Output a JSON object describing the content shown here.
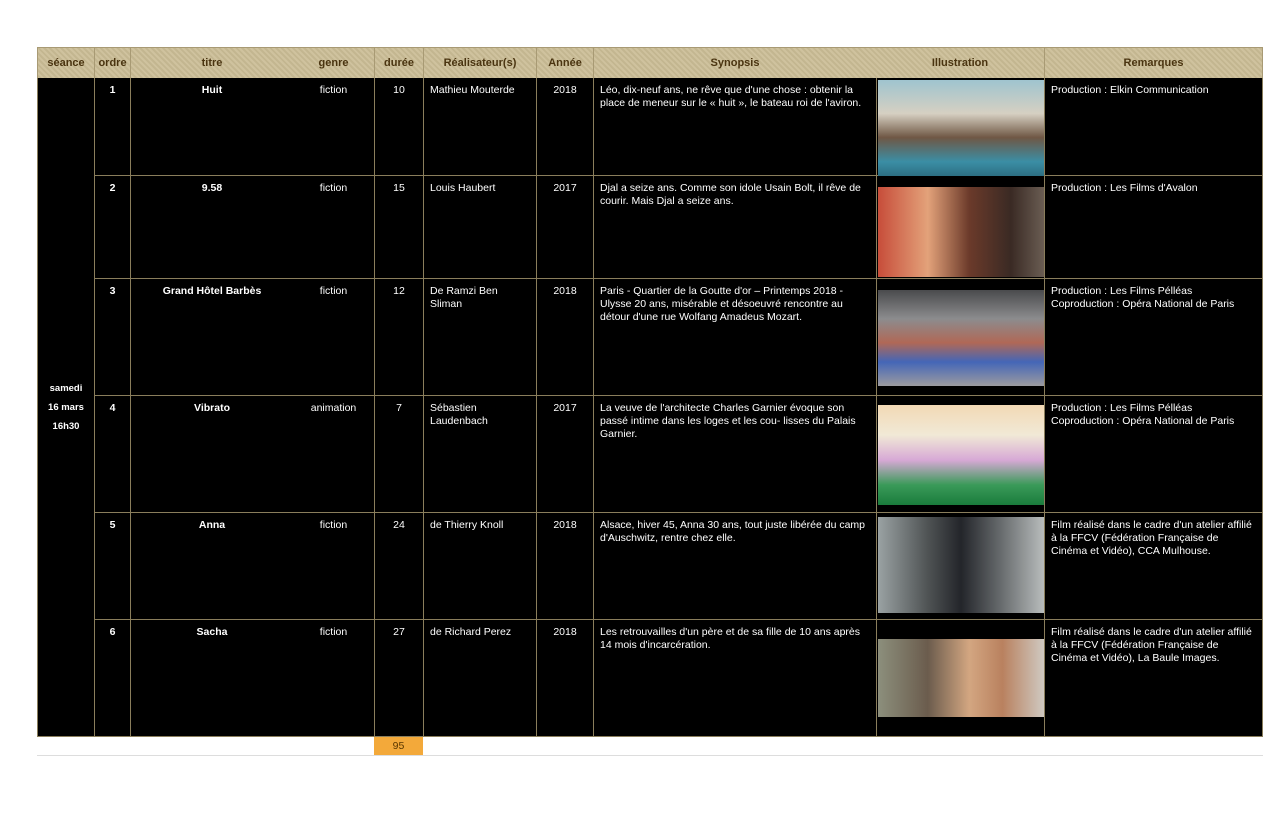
{
  "headers": {
    "seance": "séance",
    "ordre": "ordre",
    "titre": "titre",
    "genre": "genre",
    "duree": "durée",
    "realisateur": "Réalisateur(s)",
    "annee": "Année",
    "synopsis": "Synopsis",
    "illustration": "Illustration",
    "remarques": "Remarques"
  },
  "session": {
    "day": "samedi",
    "date": "16 mars",
    "time": "16h30"
  },
  "films": [
    {
      "ordre": "1",
      "titre": "Huit",
      "genre": "fiction",
      "duree": "10",
      "realisateur": "Mathieu Mouterde",
      "annee": "2018",
      "synopsis": "Léo, dix-neuf ans, ne rêve que d'une chose : obtenir la place de meneur sur le « huit », le bateau roi de l'aviron.",
      "remarques": "Production : Elkin Communication",
      "illustration": "photo-rowing"
    },
    {
      "ordre": "2",
      "titre": "9.58",
      "genre": "fiction",
      "duree": "15",
      "realisateur": "Louis Haubert",
      "annee": "2017",
      "synopsis": "Djal a seize ans. Comme son idole Usain Bolt, il rêve de courir. Mais Djal a seize ans.",
      "remarques": "Production : Les Films d'Avalon",
      "illustration": "photo-runner"
    },
    {
      "ordre": "3",
      "titre": "Grand Hôtel Barbès",
      "genre": "fiction",
      "duree": "12",
      "realisateur": "De Ramzi Ben Sliman",
      "annee": "2018",
      "synopsis": "Paris - Quartier de la Goutte d'or – Printemps 2018 - Ulysse 20 ans, misérable et désoeuvré rencontre au détour d'une rue Wolfang Amadeus Mozart.",
      "remarques": "Production : Les Films Pélléas Coproduction : Opéra National de Paris",
      "illustration": "photo-dancer"
    },
    {
      "ordre": "4",
      "titre": "Vibrato",
      "genre": "animation",
      "duree": "7",
      "realisateur": "Sébastien Laudenbach",
      "annee": "2017",
      "synopsis": "La veuve de l'architecte Charles Garnier évoque son passé intime dans les loges et les cou- lisses du Palais Garnier.",
      "remarques": "Production : Les Films Pélléas Coproduction : Opéra National de Paris",
      "illustration": "drawing-opera"
    },
    {
      "ordre": "5",
      "titre": "Anna",
      "genre": "fiction",
      "duree": "24",
      "realisateur": "de Thierry Knoll",
      "annee": "2018",
      "synopsis": "Alsace, hiver 45, Anna 30 ans, tout juste libérée du camp d'Auschwitz, rentre chez elle.",
      "remarques": "Film réalisé dans le cadre d'un atelier affilié à la FFCV (Fédération Française de Cinéma et Vidéo), CCA Mulhouse.",
      "illustration": "photo-car"
    },
    {
      "ordre": "6",
      "titre": "Sacha",
      "genre": "fiction",
      "duree": "27",
      "realisateur": "de Richard Perez",
      "annee": "2018",
      "synopsis": "Les retrouvailles d'un père et de sa fille de 10 ans après 14 mois d'incarcération.",
      "remarques": "Film réalisé dans le cadre d'un atelier affilié à la FFCV (Fédération Française de Cinéma et Vidéo), La Baule Images.",
      "illustration": "photo-embrace"
    }
  ],
  "total_duree": "95"
}
